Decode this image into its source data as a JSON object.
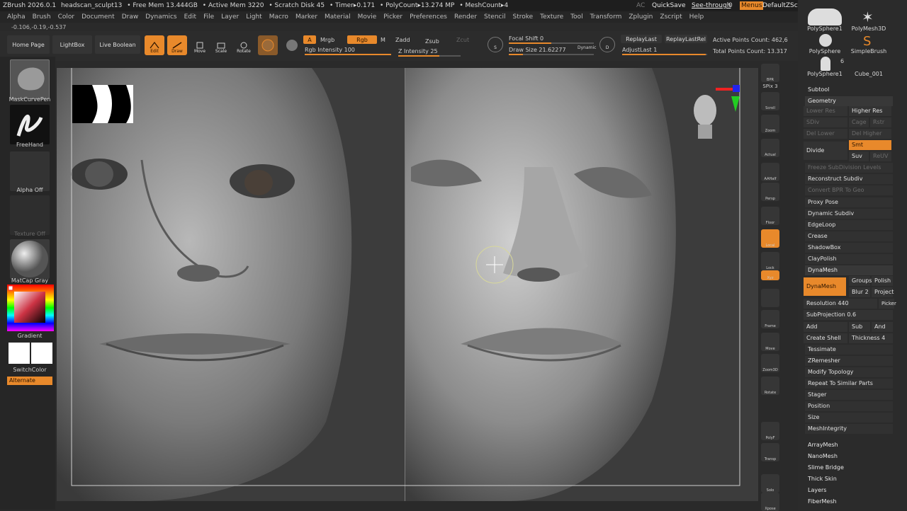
{
  "titlebar": {
    "app": "ZBrush 2026.0.1",
    "file": "headscan_sculpt13",
    "free_mem": "• Free Mem 13.444GB",
    "active_mem": "• Active Mem 3220",
    "scratch": "• Scratch Disk 45",
    "timer": "• Timer▸0.171",
    "polycount": "• PolyCount▸13.274 MP",
    "meshcount": "• MeshCount▸4",
    "ac": "AC",
    "quicksave": "QuickSave",
    "seethrough": "See-through",
    "seethrough_val": "0",
    "menus": "Menus",
    "script": "DefaultZScript"
  },
  "menubar": [
    "Alpha",
    "Brush",
    "Color",
    "Document",
    "Draw",
    "Dynamics",
    "Edit",
    "File",
    "Layer",
    "Light",
    "Macro",
    "Marker",
    "Material",
    "Movie",
    "Picker",
    "Preferences",
    "Render",
    "Stencil",
    "Stroke",
    "Texture",
    "Tool",
    "Transform",
    "Zplugin",
    "Zscript",
    "Help"
  ],
  "coords": "-0.106,-0.19,-0.537",
  "toolbar": {
    "home": "Home Page",
    "lightbox": "LightBox",
    "liveboolean": "Live Boolean",
    "edit": "Edit",
    "draw": "Draw",
    "move": "Move",
    "scale": "Scale",
    "rotate": "Rotate",
    "a": "A",
    "mrgb": "Mrgb",
    "rgb": "Rgb",
    "m": "M",
    "zadd": "Zadd",
    "zsub": "Zsub",
    "zcut": "Zcut",
    "rgb_intensity": "Rgb Intensity 100",
    "z_intensity_label": "Z Intensity",
    "z_intensity_val": "25",
    "focal_shift": "Focal Shift 0",
    "draw_size": "Draw Size 21.62277",
    "dynamic": "Dynamic",
    "s": "S",
    "d": "D",
    "replaylast": "ReplayLast",
    "replaylastrel": "ReplayLastRel",
    "adjustlast": "AdjustLast 1",
    "active_points": "Active Points Count: 462,6",
    "total_points": "Total Points Count: 13.317"
  },
  "leftpanel": {
    "brush": "MaskCurvePen",
    "stroke": "FreeHand",
    "alpha": "Alpha Off",
    "texture": "Texture Off",
    "material": "MatCap Gray",
    "gradient": "Gradient",
    "switchcolor": "SwitchColor",
    "alternate": "Alternate"
  },
  "shelf": [
    "BPR",
    "SPix 3",
    "Scroll",
    "Zoom",
    "Actual",
    "AAHalf",
    "Persp",
    "Floor",
    "Local",
    "Lock",
    "Xyz",
    "",
    "Frame",
    "Move",
    "Zoom3D",
    "Rotate",
    "Line Fill",
    "PolyF",
    "Transp",
    "Ghost",
    "Dynamic",
    "Solo",
    "Xpose"
  ],
  "tools": {
    "t1": "PolySphere1",
    "t2": "PolyMesh3D",
    "t3": "PolySphere",
    "t4": "SimpleBrush",
    "t5": "PolySphere1",
    "t5_count": "6",
    "t6": "Cube_001"
  },
  "subtool": {
    "header": "Subtool",
    "geometry": "Geometry",
    "lower_res": "Lower Res",
    "higher_res": "Higher Res",
    "sdiv": "SDiv",
    "cage": "Cage",
    "rstr": "Rstr",
    "del_lower": "Del Lower",
    "del_higher": "Del Higher",
    "divide": "Divide",
    "smt": "Smt",
    "suv": "Suv",
    "reuv": "ReUV",
    "freeze": "Freeze SubDivision Levels",
    "reconstruct": "Reconstruct Subdiv",
    "convert": "Convert BPR To Geo",
    "proxy": "Proxy Pose",
    "dynsub": "Dynamic Subdiv",
    "edgeloop": "EdgeLoop",
    "crease": "Crease",
    "shadowbox": "ShadowBox",
    "claypolish": "ClayPolish",
    "dynamesh_hdr": "DynaMesh",
    "dynamesh_btn": "DynaMesh",
    "groups": "Groups",
    "polish": "Polish",
    "blur": "Blur 2",
    "project": "Project",
    "resolution": "Resolution 440",
    "picker": "Picker",
    "subprojection": "SubProjection 0.6",
    "add": "Add",
    "sub": "Sub",
    "and": "And",
    "create_shell": "Create Shell",
    "thickness": "Thickness 4",
    "tessimate": "Tessimate",
    "zremesher": "ZRemesher",
    "modify_topology": "Modify Topology",
    "repeat": "Repeat To Similar Parts",
    "stager": "Stager",
    "position": "Position",
    "size": "Size",
    "meshintegrity": "MeshIntegrity",
    "arraymesh": "ArrayMesh",
    "nanomesh": "NanoMesh",
    "slimebridge": "Slime Bridge",
    "thickskin": "Thick Skin",
    "layers": "Layers",
    "fibermesh": "FiberMesh"
  },
  "colors": {
    "accent": "#e8892b",
    "bg": "#2a2a2a"
  }
}
